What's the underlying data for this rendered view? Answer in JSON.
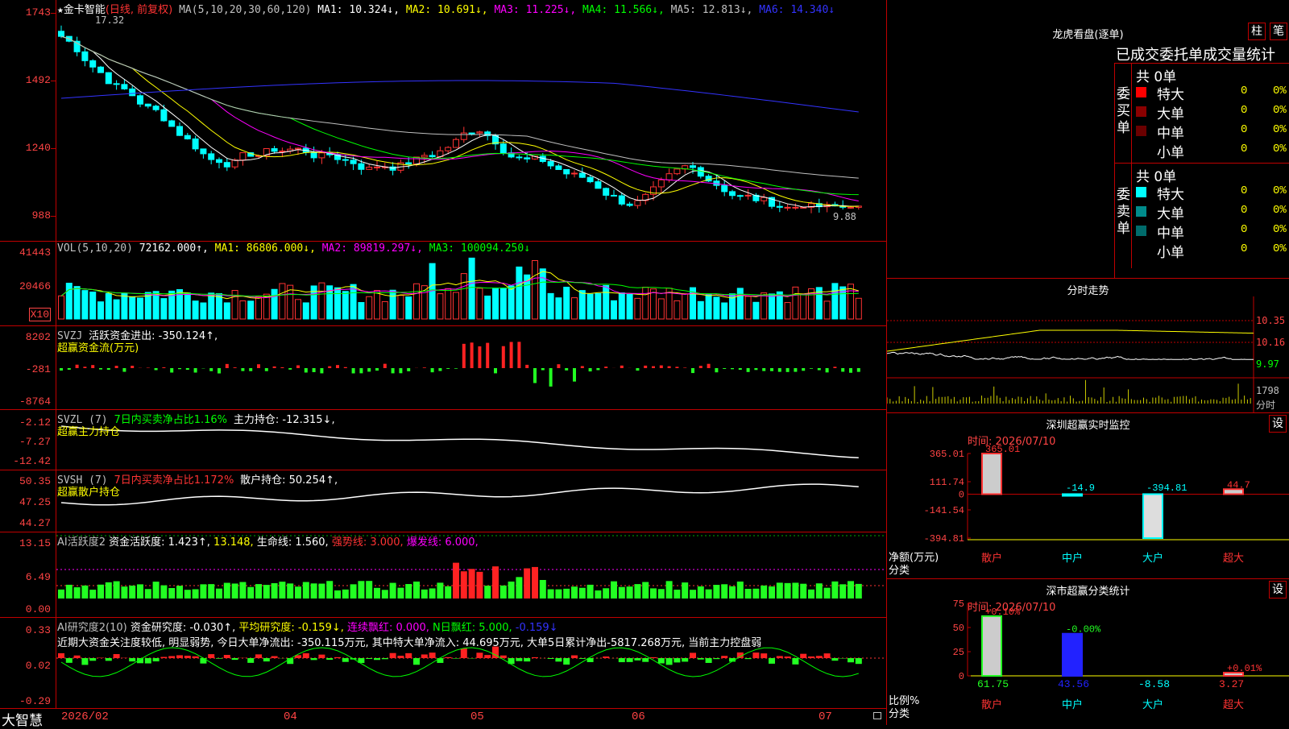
{
  "main": {
    "title_star": "★",
    "stock_name": "金卡智能",
    "period_mode": "(日线, 前复权)",
    "ma_group": "MA(5,10,20,30,60,120)",
    "ma1": "MA1: 10.324↓,",
    "ma2": "MA2: 10.691↓,",
    "ma3": "MA3: 11.225↓,",
    "ma4": "MA4: 11.566↓,",
    "ma5": "MA5: 12.813↓,",
    "ma6": "MA6: 14.340↓",
    "high_label": "17.32",
    "low_label": "9.88",
    "y_ticks": [
      "1743",
      "1492",
      "1240",
      "988"
    ],
    "colors": {
      "up": "#ff3333",
      "down": "#00ffff",
      "ma1": "#ffffff",
      "ma2": "#ffff00",
      "ma3": "#ff00ff",
      "ma4": "#00ff00",
      "ma5": "#c0c0c0",
      "ma6": "#3333ff"
    }
  },
  "vol": {
    "label": "VOL(5,10,20)",
    "value": "72162.000↑,",
    "ma1": "MA1: 86806.000↓,",
    "ma2": "MA2: 89819.297↓,",
    "ma3": "MA3: 100094.250↓",
    "y_ticks": [
      "41443",
      "20466"
    ],
    "unit": "X10"
  },
  "svzj": {
    "label": "SVZJ",
    "text": "活跃资金进出: -350.124↑,",
    "subtitle": "超赢资金流(万元)",
    "y_ticks": [
      "8202",
      "-281",
      "-8764"
    ]
  },
  "svzl": {
    "label": "SVZL (7)",
    "ratio": "7日内买卖净占比1.16%",
    "text": "主力持仓: -12.315↓,",
    "subtitle": "超赢主力持仓",
    "y_ticks": [
      "-2.12",
      "-7.27",
      "-12.42"
    ]
  },
  "svsh": {
    "label": "SVSH (7)",
    "ratio": "7日内买卖净占比1.172%",
    "text": "散户持仓: 50.254↑,",
    "subtitle": "超赢散户持仓",
    "y_ticks": [
      "50.35",
      "47.25",
      "44.27"
    ]
  },
  "ai_activity": {
    "label": "AI活跃度2",
    "v1": "资金活跃度: 1.423↑,",
    "v2": "13.148,",
    "v3": "生命线: 1.560,",
    "v4": "强势线: 3.000,",
    "v5": "爆发线: 6.000,",
    "y_ticks": [
      "13.15",
      "6.49",
      "0.00"
    ]
  },
  "ai_research": {
    "label": "AI研究度2(10)",
    "v1": "资金研究度: -0.030↑,",
    "v2": "平均研究度: -0.159↓,",
    "v3": "连续飘红: 0.000,",
    "v4": "N日飘红: 5.000,",
    "v5": "-0.159↓",
    "comment": "近期大资金关注度较低, 明显弱势, 今日大单净流出: -350.115万元, 其中特大单净流入: 44.695万元, 大单5日累计净出-5817.268万元, 当前主力控盘弱",
    "y_ticks": [
      "0.33",
      "0.02",
      "-0.29"
    ]
  },
  "xaxis": {
    "app_name": "大智慧",
    "dates": [
      "2026/02",
      "04",
      "05",
      "06",
      "07"
    ]
  },
  "dragon": {
    "title": "龙虎看盘(逐单)",
    "btn_bar": "柱",
    "btn_stroke": "笔",
    "subtitle": "已成交委托单成交量统计",
    "buy": {
      "label": "委买单",
      "total": "共 0单",
      "rows": [
        {
          "name": "特大",
          "v1": "0",
          "v2": "0%",
          "color": "#ff0000"
        },
        {
          "name": "大单",
          "v1": "0",
          "v2": "0%",
          "color": "#8b0000"
        },
        {
          "name": "中单",
          "v1": "0",
          "v2": "0%",
          "color": "#6b0000"
        },
        {
          "name": "小单",
          "v1": "0",
          "v2": "0%",
          "color": "#000000"
        }
      ]
    },
    "sell": {
      "label": "委卖单",
      "total": "共 0单",
      "rows": [
        {
          "name": "特大",
          "v1": "0",
          "v2": "0%",
          "color": "#00ffff"
        },
        {
          "name": "大单",
          "v1": "0",
          "v2": "0%",
          "color": "#008b8b"
        },
        {
          "name": "中单",
          "v1": "0",
          "v2": "0%",
          "color": "#006b6b"
        },
        {
          "name": "小单",
          "v1": "0",
          "v2": "0%",
          "color": "#000000"
        }
      ]
    }
  },
  "intraday": {
    "title": "分时走势",
    "y_ticks": [
      "10.35",
      "10.16",
      "9.97"
    ],
    "vol_tick": "1798",
    "vol_label": "分时"
  },
  "sz_monitor": {
    "title": "深圳超赢实时监控",
    "settings": "设",
    "time": "时间: 2026/07/10",
    "y_ticks": [
      "365.01",
      "111.74",
      "0",
      "-141.54",
      "-394.81"
    ],
    "ylabel": "净额(万元)",
    "xlabel": "分类",
    "chart_data": {
      "type": "bar",
      "categories": [
        "散户",
        "中户",
        "大户",
        "超大"
      ],
      "values": [
        365.01,
        -14.9,
        -394.81,
        44.7
      ],
      "value_labels": [
        "365.01",
        "-14.9",
        "-394.81",
        "44.7"
      ],
      "ylim": [
        -394.81,
        365.01
      ]
    }
  },
  "sz_class": {
    "title": "深市超赢分类统计",
    "settings": "设",
    "time": "时间: 2026/07/10",
    "y_ticks": [
      "75",
      "50",
      "25",
      "0"
    ],
    "ylabel": "比例%",
    "xlabel": "分类",
    "chart_data": {
      "type": "bar",
      "categories": [
        "散户",
        "中户",
        "大户",
        "超大"
      ],
      "values": [
        61.75,
        43.56,
        -8.58,
        3.27
      ],
      "value_labels": [
        "61.75",
        "43.56",
        "-8.58",
        "3.27"
      ],
      "change_labels": [
        "+0.10%",
        "-0.00%",
        "",
        "+0.01%"
      ],
      "ylim": [
        0,
        75
      ]
    }
  }
}
